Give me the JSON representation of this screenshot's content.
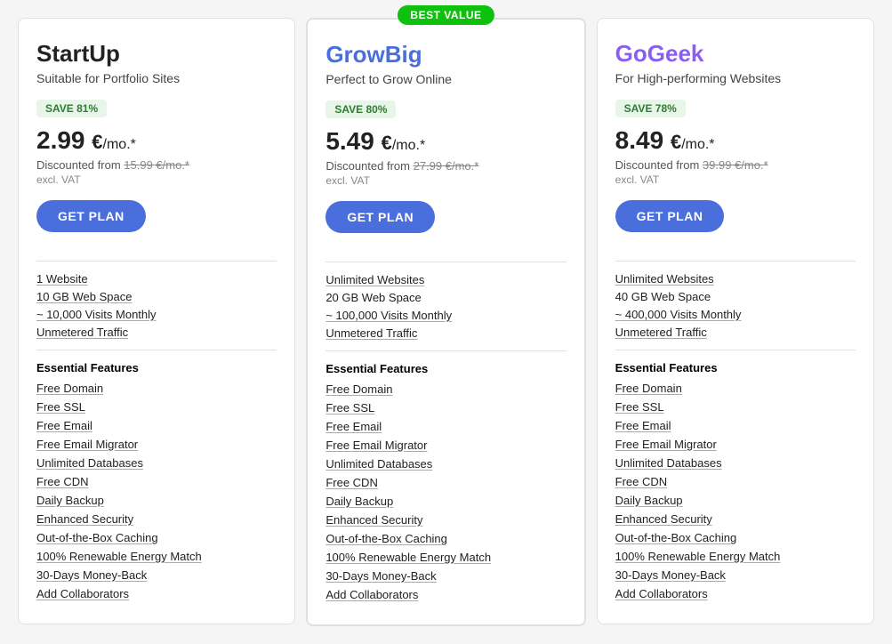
{
  "plans": [
    {
      "id": "startup",
      "name": "StartUp",
      "nameClass": "startup",
      "subtitle": "Suitable for Portfolio Sites",
      "saveBadge": "SAVE 81%",
      "price": "2.99",
      "currency": "€",
      "period": "/mo.*",
      "discountedFrom": "15.99 €/mo.*",
      "exclVat": "excl. VAT",
      "ctaLabel": "GET PLAN",
      "featured": false,
      "specs": [
        {
          "text": "1 Website",
          "underline": true
        },
        {
          "text": "10 GB Web Space",
          "underline": true
        },
        {
          "text": "~ 10,000 Visits Monthly",
          "underline": true
        },
        {
          "text": "Unmetered Traffic",
          "underline": true
        }
      ],
      "featuresHeader": "Essential Features",
      "features": [
        "Free Domain",
        "Free SSL",
        "Free Email",
        "Free Email Migrator",
        "Unlimited Databases",
        "Free CDN",
        "Daily Backup",
        "Enhanced Security",
        "Out-of-the-Box Caching",
        "100% Renewable Energy Match",
        "30-Days Money-Back",
        "Add Collaborators"
      ]
    },
    {
      "id": "growbig",
      "name": "GrowBig",
      "nameClass": "growbig",
      "subtitle": "Perfect to Grow Online",
      "saveBadge": "SAVE 80%",
      "price": "5.49",
      "currency": "€",
      "period": "/mo.*",
      "discountedFrom": "27.99 €/mo.*",
      "exclVat": "excl. VAT",
      "ctaLabel": "GET PLAN",
      "featured": true,
      "bestValueLabel": "BEST VALUE",
      "specs": [
        {
          "text": "Unlimited Websites",
          "underline": true
        },
        {
          "text": "20 GB Web Space",
          "underline": false
        },
        {
          "text": "~ 100,000 Visits Monthly",
          "underline": true
        },
        {
          "text": "Unmetered Traffic",
          "underline": true
        }
      ],
      "featuresHeader": "Essential Features",
      "features": [
        "Free Domain",
        "Free SSL",
        "Free Email",
        "Free Email Migrator",
        "Unlimited Databases",
        "Free CDN",
        "Daily Backup",
        "Enhanced Security",
        "Out-of-the-Box Caching",
        "100% Renewable Energy Match",
        "30-Days Money-Back",
        "Add Collaborators"
      ]
    },
    {
      "id": "gogeek",
      "name": "GoGeek",
      "nameClass": "gogeek",
      "subtitle": "For High-performing Websites",
      "saveBadge": "SAVE 78%",
      "price": "8.49",
      "currency": "€",
      "period": "/mo.*",
      "discountedFrom": "39.99 €/mo.*",
      "exclVat": "excl. VAT",
      "ctaLabel": "GET PLAN",
      "featured": false,
      "specs": [
        {
          "text": "Unlimited Websites",
          "underline": true
        },
        {
          "text": "40 GB Web Space",
          "underline": false
        },
        {
          "text": "~ 400,000 Visits Monthly",
          "underline": true
        },
        {
          "text": "Unmetered Traffic",
          "underline": true
        }
      ],
      "featuresHeader": "Essential Features",
      "features": [
        "Free Domain",
        "Free SSL",
        "Free Email",
        "Free Email Migrator",
        "Unlimited Databases",
        "Free CDN",
        "Daily Backup",
        "Enhanced Security",
        "Out-of-the-Box Caching",
        "100% Renewable Energy Match",
        "30-Days Money-Back",
        "Add Collaborators"
      ]
    }
  ]
}
